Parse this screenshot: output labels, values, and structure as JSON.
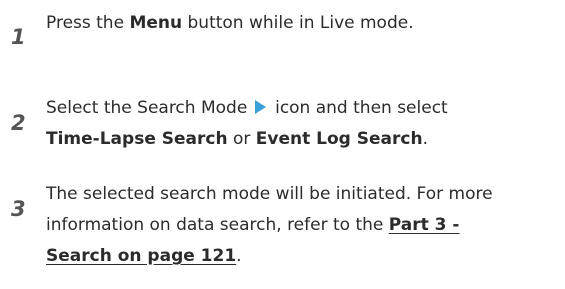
{
  "steps": [
    {
      "number": "1",
      "line1_pre": "Press the ",
      "line1_bold": "Menu",
      "line1_post": " button while in Live mode."
    },
    {
      "number": "2",
      "line1_pre": "Select the Search Mode ",
      "line1_post": " icon and then select",
      "icon": "play-icon",
      "line2_bold1": "Time-Lapse Search",
      "line2_mid": " or ",
      "line2_bold2": "Event Log Search",
      "line2_post": "."
    },
    {
      "number": "3",
      "line1": "The selected search mode will be initiated. For more",
      "line2_pre": "information on data search, refer to the ",
      "link_part1": "Part 3 - ",
      "link_part2": "Search on page 121",
      "line3_post": "."
    }
  ],
  "colors": {
    "text": "#2b2b2b",
    "step_number": "#555555",
    "icon_accent": "#3aa0d8"
  }
}
